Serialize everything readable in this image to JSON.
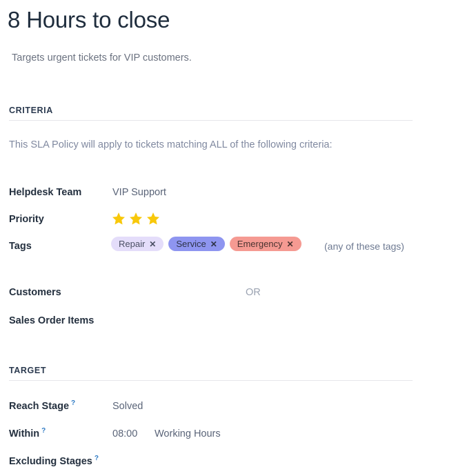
{
  "header": {
    "title": "8 Hours to close",
    "subtitle": "Targets urgent tickets for VIP customers."
  },
  "criteria": {
    "section_label": "CRITERIA",
    "note": "This SLA Policy will apply to tickets matching ALL of the following criteria:",
    "rows": {
      "helpdesk_team": {
        "label": "Helpdesk Team",
        "value": "VIP Support"
      },
      "priority": {
        "label": "Priority",
        "stars": 3,
        "star_color": "#f8c80a"
      },
      "tags": {
        "label": "Tags",
        "hint": "(any of these tags)",
        "items": [
          {
            "name": "Repair",
            "close": "✕",
            "bg": "#e4ddfa",
            "fg": "#4a4f63"
          },
          {
            "name": "Service",
            "close": "✕",
            "bg": "#8e95f0",
            "fg": "#2d3347"
          },
          {
            "name": "Emergency",
            "close": "✕",
            "bg": "#f59a92",
            "fg": "#4a3330"
          }
        ]
      },
      "customers": {
        "label": "Customers",
        "value": ""
      },
      "or_separator": "OR",
      "sales_order_items": {
        "label": "Sales Order Items",
        "value": ""
      }
    }
  },
  "target": {
    "section_label": "TARGET",
    "rows": {
      "reach_stage": {
        "label": "Reach Stage",
        "help": "?",
        "value": "Solved"
      },
      "within": {
        "label": "Within",
        "help": "?",
        "value": "08:00",
        "unit": "Working Hours"
      },
      "excluding_stages": {
        "label": "Excluding Stages",
        "help": "?",
        "value": ""
      }
    }
  }
}
